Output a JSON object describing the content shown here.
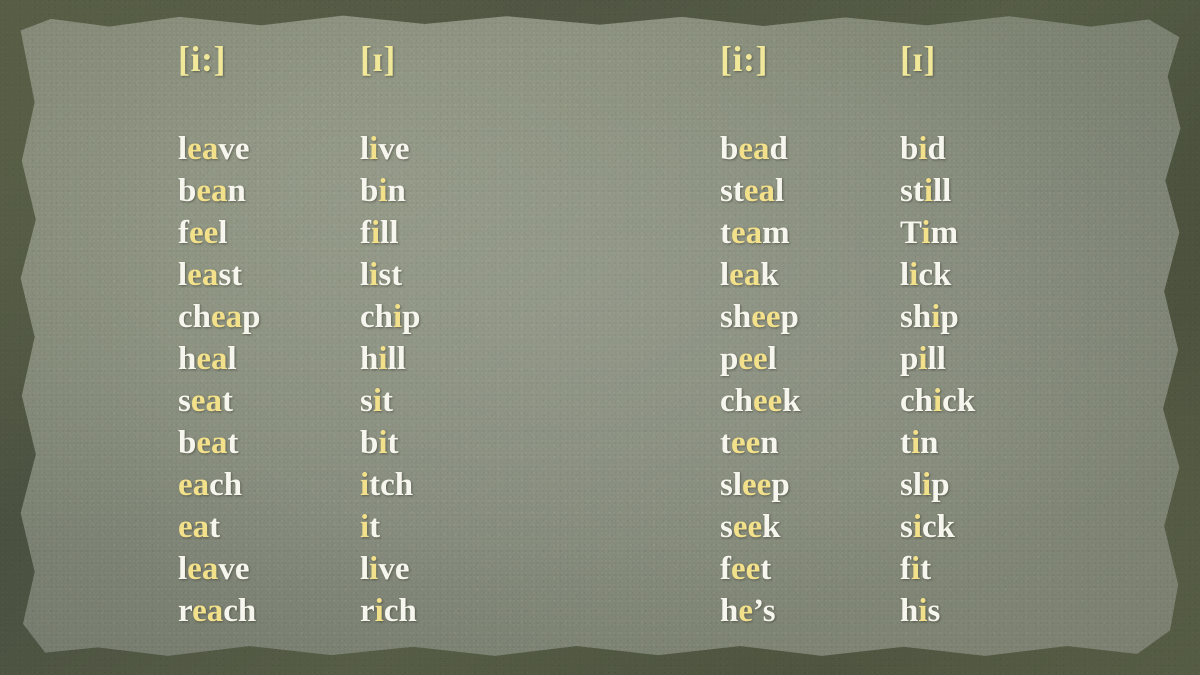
{
  "slide": {
    "background_border_color": "#4b5140",
    "paper_color": "#848a7c",
    "highlight_color": "#f2e08a",
    "text_color": "#f7f6ee",
    "header_color": "#f2e89a"
  },
  "columns": [
    {
      "id": "col-1",
      "header": "[i:]",
      "header_name": "long-ee-header-left",
      "words": [
        {
          "pre": "l",
          "hl": "ea",
          "post": "ve",
          "text": "leave"
        },
        {
          "pre": "b",
          "hl": "ea",
          "post": "n",
          "text": "bean"
        },
        {
          "pre": "f",
          "hl": "ee",
          "post": "l",
          "text": "feel"
        },
        {
          "pre": "l",
          "hl": "ea",
          "post": "st",
          "text": "least"
        },
        {
          "pre": "ch",
          "hl": "ea",
          "post": "p",
          "text": "cheap"
        },
        {
          "pre": "h",
          "hl": "ea",
          "post": "l",
          "text": "heal"
        },
        {
          "pre": "s",
          "hl": "ea",
          "post": "t",
          "text": "seat"
        },
        {
          "pre": "b",
          "hl": "ea",
          "post": "t",
          "text": "beat"
        },
        {
          "pre": "",
          "hl": "ea",
          "post": "ch",
          "text": "each"
        },
        {
          "pre": "",
          "hl": "ea",
          "post": "t",
          "text": "eat"
        },
        {
          "pre": "l",
          "hl": "ea",
          "post": "ve",
          "text": "leave"
        },
        {
          "pre": "r",
          "hl": "ea",
          "post": "ch",
          "text": "reach"
        }
      ]
    },
    {
      "id": "col-2",
      "header": "[ɪ]",
      "header_name": "short-i-header-left",
      "words": [
        {
          "pre": "l",
          "hl": "i",
          "post": "ve",
          "text": "live"
        },
        {
          "pre": "b",
          "hl": "i",
          "post": "n",
          "text": "bin"
        },
        {
          "pre": "f",
          "hl": "i",
          "post": "ll",
          "text": "fill"
        },
        {
          "pre": "l",
          "hl": "i",
          "post": "st",
          "text": "list"
        },
        {
          "pre": "ch",
          "hl": "i",
          "post": "p",
          "text": "chip"
        },
        {
          "pre": "h",
          "hl": "i",
          "post": "ll",
          "text": "hill"
        },
        {
          "pre": "s",
          "hl": "i",
          "post": "t",
          "text": "sit"
        },
        {
          "pre": "b",
          "hl": "i",
          "post": "t",
          "text": "bit"
        },
        {
          "pre": "",
          "hl": "i",
          "post": "tch",
          "text": "itch"
        },
        {
          "pre": "",
          "hl": "i",
          "post": "t",
          "text": "it"
        },
        {
          "pre": "l",
          "hl": "i",
          "post": "ve",
          "text": "live"
        },
        {
          "pre": "r",
          "hl": "i",
          "post": "ch",
          "text": "rich"
        }
      ]
    },
    {
      "id": "col-3",
      "header": "[i:]",
      "header_name": "long-ee-header-right",
      "words": [
        {
          "pre": "b",
          "hl": "ea",
          "post": "d",
          "text": "bead"
        },
        {
          "pre": "st",
          "hl": "ea",
          "post": "l",
          "text": "steal"
        },
        {
          "pre": "t",
          "hl": "ea",
          "post": "m",
          "text": "team"
        },
        {
          "pre": "l",
          "hl": "ea",
          "post": "k",
          "text": "leak"
        },
        {
          "pre": "sh",
          "hl": "ee",
          "post": "p",
          "text": "sheep"
        },
        {
          "pre": "p",
          "hl": "ee",
          "post": "l",
          "text": "peel"
        },
        {
          "pre": "ch",
          "hl": "ee",
          "post": "k",
          "text": "cheek"
        },
        {
          "pre": "t",
          "hl": "ee",
          "post": "n",
          "text": "teen"
        },
        {
          "pre": "sl",
          "hl": "ee",
          "post": "p",
          "text": "sleep"
        },
        {
          "pre": "s",
          "hl": "ee",
          "post": "k",
          "text": "seek"
        },
        {
          "pre": "f",
          "hl": "ee",
          "post": "t",
          "text": "feet"
        },
        {
          "pre": "h",
          "hl": "e",
          "post": "’s",
          "text": "he’s"
        }
      ]
    },
    {
      "id": "col-4",
      "header": "[ɪ]",
      "header_name": "short-i-header-right",
      "words": [
        {
          "pre": "b",
          "hl": "i",
          "post": "d",
          "text": "bid"
        },
        {
          "pre": "st",
          "hl": "i",
          "post": "ll",
          "text": "still"
        },
        {
          "pre": "T",
          "hl": "i",
          "post": "m",
          "text": "Tim"
        },
        {
          "pre": "l",
          "hl": "i",
          "post": "ck",
          "text": "lick"
        },
        {
          "pre": "sh",
          "hl": "i",
          "post": "p",
          "text": "ship"
        },
        {
          "pre": "p",
          "hl": "i",
          "post": "ll",
          "text": "pill"
        },
        {
          "pre": "ch",
          "hl": "i",
          "post": "ck",
          "text": "chick"
        },
        {
          "pre": "t",
          "hl": "i",
          "post": "n",
          "text": "tin"
        },
        {
          "pre": "sl",
          "hl": "i",
          "post": "p",
          "text": "slip"
        },
        {
          "pre": "s",
          "hl": "i",
          "post": "ck",
          "text": "sick"
        },
        {
          "pre": "f",
          "hl": "i",
          "post": "t",
          "text": "fit"
        },
        {
          "pre": "h",
          "hl": "i",
          "post": "s",
          "text": "his"
        }
      ]
    }
  ]
}
